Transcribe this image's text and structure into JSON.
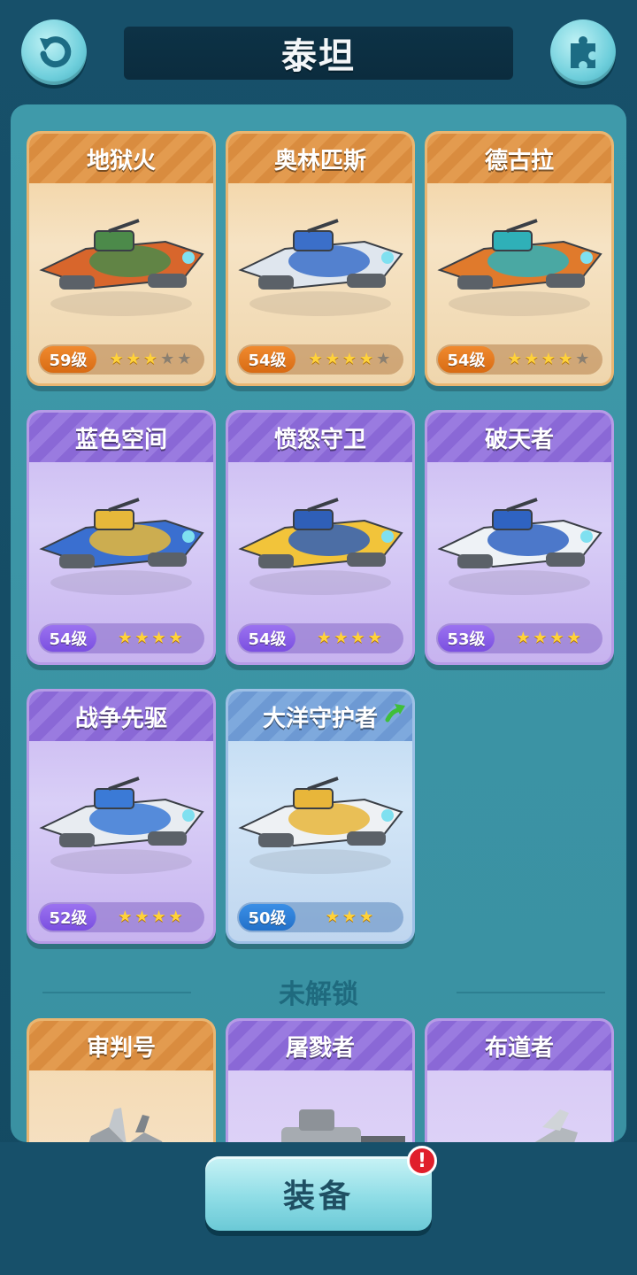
{
  "header": {
    "title": "泰坦",
    "back_icon": "back-arrow-icon",
    "settings_icon": "puzzle-icon"
  },
  "owned_ships": [
    {
      "name": "地狱火",
      "level": "59级",
      "stars": 3,
      "max_stars": 5,
      "rarity": "orange",
      "ship_colors": [
        "#d8662c",
        "#4c8a4a"
      ]
    },
    {
      "name": "奥林匹斯",
      "level": "54级",
      "stars": 4,
      "max_stars": 5,
      "rarity": "orange",
      "ship_colors": [
        "#dfe6ee",
        "#3b6fc9"
      ]
    },
    {
      "name": "德古拉",
      "level": "54级",
      "stars": 4,
      "max_stars": 5,
      "rarity": "orange",
      "ship_colors": [
        "#e07a2c",
        "#2fb0b8"
      ]
    },
    {
      "name": "蓝色空间",
      "level": "54级",
      "stars": 4,
      "max_stars": 4,
      "rarity": "purple",
      "ship_colors": [
        "#3a6fd0",
        "#e6b83a"
      ]
    },
    {
      "name": "愤怒守卫",
      "level": "54级",
      "stars": 4,
      "max_stars": 4,
      "rarity": "purple",
      "ship_colors": [
        "#f2c43a",
        "#2f5fb8"
      ]
    },
    {
      "name": "破天者",
      "level": "53级",
      "stars": 4,
      "max_stars": 4,
      "rarity": "purple",
      "ship_colors": [
        "#eef2f6",
        "#2f63c2"
      ]
    },
    {
      "name": "战争先驱",
      "level": "52级",
      "stars": 4,
      "max_stars": 4,
      "rarity": "purple",
      "ship_colors": [
        "#e8ecf1",
        "#3b7ad6"
      ]
    },
    {
      "name": "大洋守护者",
      "level": "50级",
      "stars": 3,
      "max_stars": 3,
      "rarity": "blue",
      "upgrade_available": true,
      "ship_colors": [
        "#eef1f4",
        "#e8b63a"
      ]
    }
  ],
  "locked_section": {
    "label": "未解锁",
    "ships": [
      {
        "name": "审判号",
        "rarity": "orange"
      },
      {
        "name": "屠戮者",
        "rarity": "purple"
      },
      {
        "name": "布道者",
        "rarity": "purple"
      }
    ]
  },
  "equip_button": {
    "label": "装备",
    "badge": "!"
  },
  "colors": {
    "background": "#17506a",
    "panel": "#3f9aaa",
    "star_on": "#ffd23a",
    "notify": "#e01f2b"
  }
}
